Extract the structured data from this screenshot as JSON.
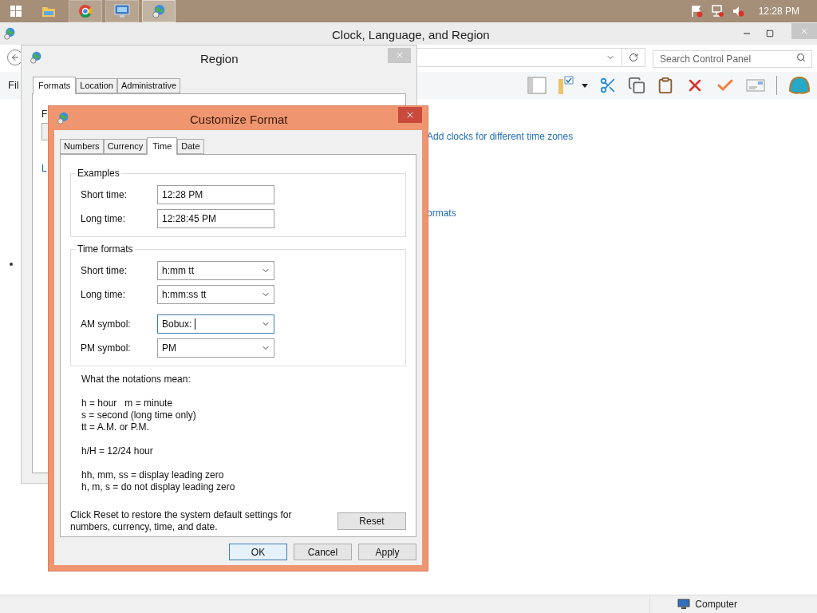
{
  "taskbar": {
    "apps": [
      {
        "kind": "explorer",
        "selected": false
      },
      {
        "kind": "chrome",
        "selected": false
      },
      {
        "kind": "monitor",
        "selected": false
      },
      {
        "kind": "globe",
        "selected": true
      }
    ],
    "clock": "12:28 PM"
  },
  "main_window": {
    "title": "Clock, Language, and Region",
    "search": {
      "placeholder": "Search Control Panel"
    },
    "menu": [
      "Fil"
    ],
    "links": [
      "Add clocks for different time zones",
      "ormats"
    ],
    "status": "Computer"
  },
  "region_dialog": {
    "title": "Region",
    "tabs": [
      {
        "label": "Formats",
        "selected": true
      },
      {
        "label": "Location",
        "selected": false
      },
      {
        "label": "Administrative",
        "selected": false
      }
    ],
    "fragments": [
      "F",
      "L"
    ]
  },
  "customize": {
    "title": "Customize Format",
    "tabs": [
      {
        "label": "Numbers",
        "selected": false
      },
      {
        "label": "Currency",
        "selected": false
      },
      {
        "label": "Time",
        "selected": true
      },
      {
        "label": "Date",
        "selected": false
      }
    ],
    "examples": {
      "title": "Examples",
      "rows": [
        {
          "label": "Short time:",
          "value": "12:28 PM"
        },
        {
          "label": "Long time:",
          "value": "12:28:45 PM"
        }
      ]
    },
    "time_formats": {
      "title": "Time formats",
      "rows": [
        {
          "label": "Short time:",
          "value": "h:mm tt",
          "focused": false
        },
        {
          "label": "Long time:",
          "value": "h:mm:ss tt",
          "focused": false
        },
        {
          "label": "AM symbol:",
          "value": "Bobux:",
          "focused": true
        },
        {
          "label": "PM symbol:",
          "value": "PM",
          "focused": false
        }
      ]
    },
    "notes": [
      [
        "What the notations mean:"
      ],
      [
        "h = hour   m = minute",
        "s = second (long time only)",
        "tt = A.M. or P.M."
      ],
      [
        "h/H = 12/24 hour"
      ],
      [
        "hh, mm, ss = display leading zero",
        "h, m, s = do not display leading zero"
      ]
    ],
    "reset_text": [
      "Click Reset to restore the system default settings for",
      "numbers, currency, time, and date."
    ],
    "reset": "Reset",
    "buttons": [
      {
        "label": "OK",
        "default": true
      },
      {
        "label": "Cancel",
        "default": false
      },
      {
        "label": "Apply",
        "default": false
      }
    ]
  }
}
